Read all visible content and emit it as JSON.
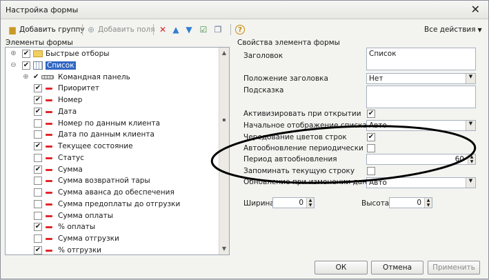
{
  "window": {
    "title": "Настройка формы"
  },
  "toolbar": {
    "add_group": "Добавить группу",
    "add_field": "Добавить поля",
    "all_actions": "Все действия",
    "help_label": "?"
  },
  "left_panel": {
    "title": "Элементы формы",
    "tree": [
      {
        "label": "Быстрые отборы",
        "checked": true,
        "level": 0,
        "expander": "+"
      },
      {
        "label": "Список",
        "checked": true,
        "level": 0,
        "expander": "−",
        "selected": true
      },
      {
        "label": "Командная панель",
        "checked": true,
        "level": 1,
        "expander": "+"
      },
      {
        "label": "Приоритет",
        "checked": true,
        "level": 2
      },
      {
        "label": "Номер",
        "checked": true,
        "level": 2
      },
      {
        "label": "Дата",
        "checked": true,
        "level": 2
      },
      {
        "label": "Номер по данным клиента",
        "checked": false,
        "level": 2
      },
      {
        "label": "Дата по данным клиента",
        "checked": false,
        "level": 2
      },
      {
        "label": "Текущее состояние",
        "checked": true,
        "level": 2
      },
      {
        "label": "Статус",
        "checked": false,
        "level": 2
      },
      {
        "label": "Сумма",
        "checked": true,
        "level": 2
      },
      {
        "label": "Сумма возвратной тары",
        "checked": false,
        "level": 2
      },
      {
        "label": "Сумма аванса до обеспечения",
        "checked": false,
        "level": 2
      },
      {
        "label": "Сумма предоплаты до отгрузки",
        "checked": false,
        "level": 2
      },
      {
        "label": "Сумма оплаты",
        "checked": false,
        "level": 2
      },
      {
        "label": "% оплаты",
        "checked": true,
        "level": 2
      },
      {
        "label": "Сумма отгрузки",
        "checked": false,
        "level": 2
      },
      {
        "label": "% отгрузки",
        "checked": true,
        "level": 2
      }
    ]
  },
  "right_panel": {
    "title": "Свойства элемента формы",
    "header_label": "Заголовок",
    "header_value": "Список",
    "header_position_label": "Положение заголовка",
    "header_position_value": "Нет",
    "hint_label": "Подсказка",
    "hint_value": "",
    "activate_label": "Активизировать при открытии",
    "activate_checked": true,
    "initial_view_label": "Начальное отображение списка",
    "initial_view_value": "Авто",
    "alternate_colors_label": "Чередование цветов строк",
    "alternate_colors_checked": true,
    "auto_refresh_label": "Автообновление периодически",
    "auto_refresh_checked": false,
    "refresh_period_label": "Период автообновления",
    "refresh_period_value": "60",
    "remember_row_label": "Запоминать текущую строку",
    "remember_row_checked": false,
    "update_on_change_label": "Обновление при изменении данных",
    "update_on_change_value": "Авто",
    "width_label": "Ширина",
    "width_value": "0",
    "height_label": "Высота",
    "height_value": "0"
  },
  "buttons": {
    "ok": "ОК",
    "cancel": "Отмена",
    "apply": "Применить"
  },
  "colors": {
    "selection": "#2f66c3",
    "field_icon": "#e0252b",
    "annotation": "#000000"
  }
}
